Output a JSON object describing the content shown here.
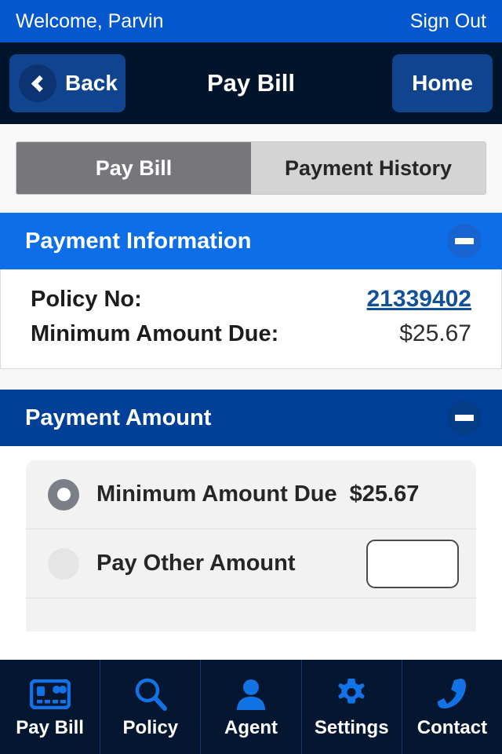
{
  "topbar": {
    "welcome": "Welcome, Parvin",
    "signout": "Sign Out"
  },
  "navbar": {
    "back": "Back",
    "title": "Pay Bill",
    "home": "Home"
  },
  "tabs": {
    "items": [
      {
        "label": "Pay Bill",
        "active": true
      },
      {
        "label": "Payment History",
        "active": false
      }
    ]
  },
  "payment_information": {
    "title": "Payment Information",
    "collapse_icon": "minus-icon",
    "rows": [
      {
        "label": "Policy No:",
        "value": "21339402",
        "type": "link"
      },
      {
        "label": "Minimum Amount Due:",
        "value": "$25.67",
        "type": "text"
      }
    ]
  },
  "payment_amount": {
    "title": "Payment Amount",
    "collapse_icon": "minus-icon",
    "options": [
      {
        "label": "Minimum Amount Due",
        "amount": "$25.67",
        "selected": true
      },
      {
        "label": "Pay Other Amount",
        "input_value": "",
        "input_placeholder": "",
        "selected": false
      }
    ]
  },
  "bottom_nav": {
    "items": [
      {
        "label": "Pay Bill",
        "icon": "credit-card-icon"
      },
      {
        "label": "Policy",
        "icon": "magnifier-icon"
      },
      {
        "label": "Agent",
        "icon": "person-icon"
      },
      {
        "label": "Settings",
        "icon": "gear-icon"
      },
      {
        "label": "Contact",
        "icon": "phone-icon"
      }
    ]
  },
  "colors": {
    "welcome_bar": "#0557ce",
    "navbar": "#00142c",
    "nav_button": "#10448f",
    "section_light": "#0d6ee8",
    "section_dark": "#004098",
    "tab_active": "#77777b",
    "tab_inactive": "#d4d4d4",
    "link": "#14509a",
    "tabbar_bg": "#051630",
    "tabbar_icon": "#1273e6"
  }
}
